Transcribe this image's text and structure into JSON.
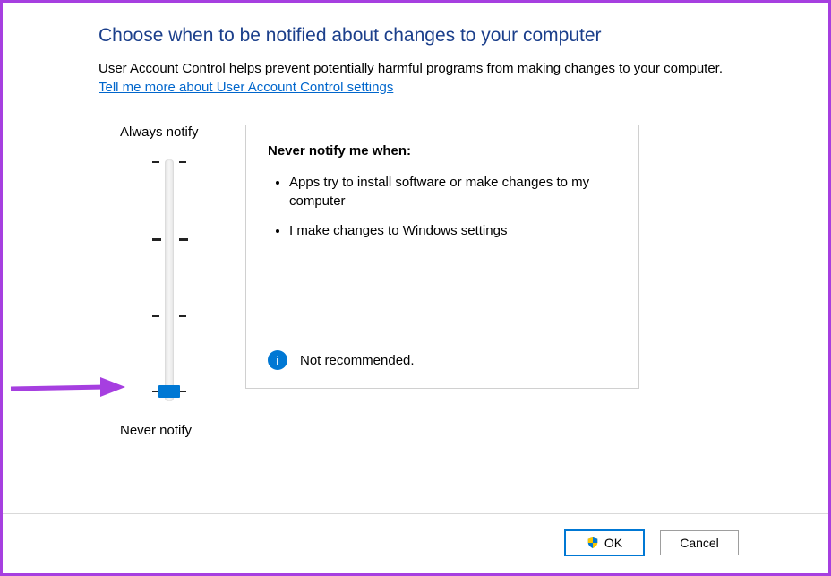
{
  "heading": "Choose when to be notified about changes to your computer",
  "description": "User Account Control helps prevent potentially harmful programs from making changes to your computer.",
  "help_link": "Tell me more about User Account Control settings",
  "slider": {
    "top_label": "Always notify",
    "bottom_label": "Never notify"
  },
  "panel": {
    "title": "Never notify me when:",
    "bullets": [
      "Apps try to install software or make changes to my computer",
      "I make changes to Windows settings"
    ],
    "footer_text": "Not recommended."
  },
  "buttons": {
    "ok": "OK",
    "cancel": "Cancel"
  },
  "colors": {
    "accent": "#0078d4",
    "annotation": "#a63fe0"
  }
}
